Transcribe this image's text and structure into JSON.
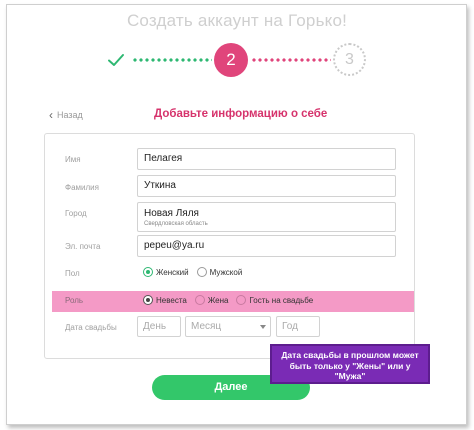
{
  "page_title": "Создать аккаунт на Горько!",
  "stepper": {
    "step2_label": "2",
    "step3_label": "3",
    "colors": {
      "done": "#2eb872",
      "active": "#e0457b",
      "pending": "#c9c9c9"
    }
  },
  "header": {
    "back_label": "Назад",
    "section_title": "Добавьте информацию о себе"
  },
  "form": {
    "name": {
      "label": "Имя",
      "value": "Пелагея"
    },
    "surname": {
      "label": "Фамилия",
      "value": "Уткина"
    },
    "city": {
      "label": "Город",
      "value": "Новая Ляля",
      "region": "Свердловская область"
    },
    "email": {
      "label": "Эл. почта",
      "value": "pepeu@ya.ru"
    },
    "gender": {
      "label": "Пол",
      "options": [
        "Женский",
        "Мужской"
      ],
      "selected": "Женский"
    },
    "role": {
      "label": "Роль",
      "options": [
        "Невеста",
        "Жена",
        "Гость на свадьбе"
      ],
      "selected": "Невеста"
    },
    "wedding_date": {
      "label": "Дата свадьбы",
      "day_placeholder": "День",
      "month_placeholder": "Месяц",
      "year_placeholder": "Год"
    }
  },
  "submit_label": "Далее",
  "callout_text": "Дата свадьбы в прошлом может быть только у \"Жены\" или у \"Мужа\"",
  "colors": {
    "accent_pink": "#d6336c",
    "highlight_band": "#f49ac6",
    "submit_green": "#33c76a",
    "callout_purple": "#7a2bb5"
  }
}
